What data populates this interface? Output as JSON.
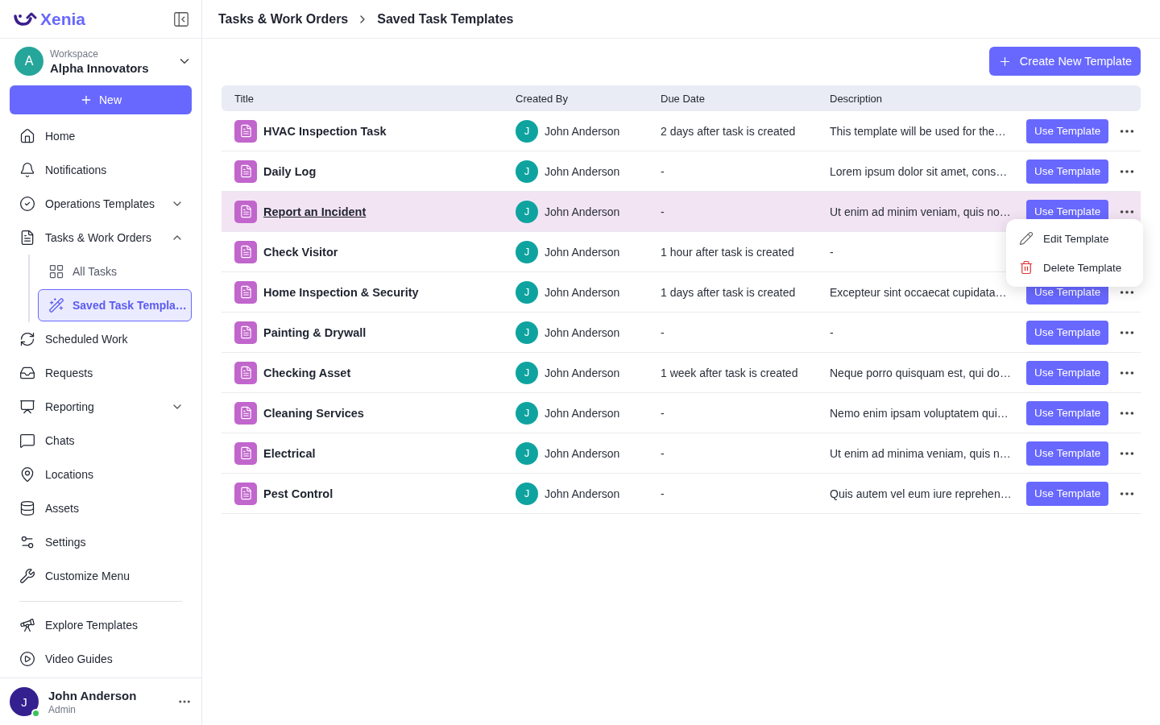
{
  "brand": "Xenia",
  "workspace": {
    "label": "Workspace",
    "name": "Alpha Innovators",
    "initial": "A"
  },
  "new_button": "New",
  "nav": [
    {
      "label": "Home"
    },
    {
      "label": "Notifications"
    },
    {
      "label": "Operations Templates",
      "expanded": false
    },
    {
      "label": "Tasks & Work Orders",
      "expanded": true,
      "children": [
        {
          "label": "All Tasks",
          "selected": false
        },
        {
          "label": "Saved Task Templa…",
          "selected": true
        }
      ]
    },
    {
      "label": "Scheduled Work"
    },
    {
      "label": "Requests"
    },
    {
      "label": "Reporting",
      "expanded": false
    },
    {
      "label": "Chats"
    },
    {
      "label": "Locations"
    },
    {
      "label": "Assets"
    },
    {
      "label": "Settings"
    },
    {
      "label": "Customize Menu"
    }
  ],
  "nav_bottom": [
    {
      "label": "Explore Templates"
    },
    {
      "label": "Video Guides"
    }
  ],
  "user": {
    "name": "John Anderson",
    "role": "Admin",
    "initial": "J",
    "online": true
  },
  "breadcrumb": [
    "Tasks & Work Orders",
    "Saved Task Templates"
  ],
  "create_button": "Create New Template",
  "table": {
    "columns": [
      "Title",
      "Created By",
      "Due Date",
      "Description"
    ],
    "rows": [
      {
        "title": "HVAC Inspection Task",
        "creator": "John Anderson",
        "initial": "J",
        "due": "2 days after task is created",
        "description": "This template will be used for the…",
        "action": "Use Template",
        "highlighted": false
      },
      {
        "title": "Daily Log",
        "creator": "John Anderson",
        "initial": "J",
        "due": "-",
        "description": "Lorem ipsum dolor sit amet, cons…",
        "action": "Use Template",
        "highlighted": false
      },
      {
        "title": "Report an Incident",
        "creator": "John Anderson",
        "initial": "J",
        "due": "-",
        "description": "Ut enim ad minim veniam, quis no…",
        "action": "Use Template",
        "highlighted": true,
        "menu": [
          {
            "kind": "edit",
            "label": "Edit Template"
          },
          {
            "kind": "delete",
            "label": "Delete Template"
          }
        ]
      },
      {
        "title": "Check Visitor",
        "creator": "John Anderson",
        "initial": "J",
        "due": "1 hour after task is created",
        "description": "-",
        "highlighted": false
      },
      {
        "title": "Home Inspection & Security",
        "creator": "John Anderson",
        "initial": "J",
        "due": "1 days after task is created",
        "description": "Excepteur sint occaecat cupidata…",
        "action": "Use Template",
        "highlighted": false
      },
      {
        "title": "Painting & Drywall",
        "creator": "John Anderson",
        "initial": "J",
        "due": "-",
        "description": "-",
        "action": "Use Template",
        "highlighted": false
      },
      {
        "title": "Checking Asset",
        "creator": "John Anderson",
        "initial": "J",
        "due": "1 week after task is created",
        "description": "Neque porro quisquam est, qui do…",
        "action": "Use Template",
        "highlighted": false
      },
      {
        "title": "Cleaning Services",
        "creator": "John Anderson",
        "initial": "J",
        "due": "-",
        "description": "Nemo enim ipsam voluptatem qui…",
        "action": "Use Template",
        "highlighted": false
      },
      {
        "title": "Electrical",
        "creator": "John Anderson",
        "initial": "J",
        "due": "-",
        "description": "Ut enim ad minima veniam, quis n…",
        "action": "Use Template",
        "highlighted": false
      },
      {
        "title": "Pest Control",
        "creator": "John Anderson",
        "initial": "J",
        "due": "-",
        "description": "Quis autem vel eum iure reprehen…",
        "action": "Use Template",
        "highlighted": false
      }
    ]
  }
}
